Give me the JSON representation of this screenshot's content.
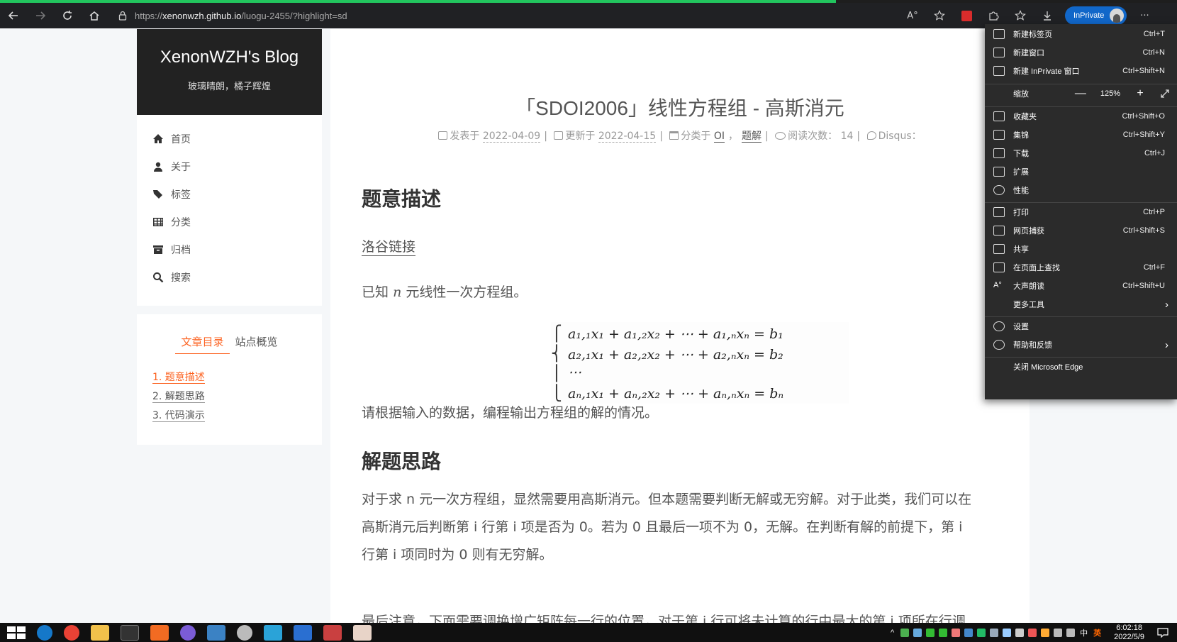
{
  "browser": {
    "page_load_progress": 0.71,
    "url_prefix": "https://",
    "url_host": "xenonwzh.github.io",
    "url_path": "/luogu-2455/?highlight=sd",
    "inprivate_label": "InPrivate",
    "more_label": "···",
    "read_aloud_label": "A°",
    "context_menu": {
      "new_tab": {
        "label": "新建标签页",
        "shortcut": "Ctrl+T"
      },
      "new_window": {
        "label": "新建窗口",
        "shortcut": "Ctrl+N"
      },
      "new_inprivate": {
        "label": "新建 InPrivate 窗口",
        "shortcut": "Ctrl+Shift+N"
      },
      "zoom": {
        "label": "缩放",
        "value": "125%",
        "minus": "—",
        "plus": "+"
      },
      "favorites": {
        "label": "收藏夹",
        "shortcut": "Ctrl+Shift+O"
      },
      "collections": {
        "label": "集锦",
        "shortcut": "Ctrl+Shift+Y"
      },
      "downloads": {
        "label": "下载",
        "shortcut": "Ctrl+J"
      },
      "extensions": {
        "label": "扩展"
      },
      "performance": {
        "label": "性能"
      },
      "print": {
        "label": "打印",
        "shortcut": "Ctrl+P"
      },
      "web_capture": {
        "label": "网页捕获",
        "shortcut": "Ctrl+Shift+S"
      },
      "share": {
        "label": "共享"
      },
      "find": {
        "label": "在页面上查找",
        "shortcut": "Ctrl+F"
      },
      "read_aloud": {
        "label": "大声朗读",
        "shortcut": "Ctrl+Shift+U"
      },
      "more_tools": {
        "label": "更多工具"
      },
      "settings": {
        "label": "设置"
      },
      "help": {
        "label": "帮助和反馈"
      },
      "close": {
        "label": "关闭 Microsoft Edge"
      }
    }
  },
  "blog": {
    "title": "XenonWZH's Blog",
    "subtitle": "玻璃晴朗，橘子辉煌",
    "menu": [
      "首页",
      "关于",
      "标签",
      "分类",
      "归档",
      "搜索"
    ],
    "toc_tabs": [
      "文章目录",
      "站点概览"
    ],
    "toc": [
      "1. 题意描述",
      "2. 解题思路",
      "3. 代码演示"
    ]
  },
  "post": {
    "title": "「SDOI2006」线性方程组 - 高斯消元",
    "meta": {
      "posted_label": "发表于",
      "posted_date": "2022-04-09",
      "updated_label": "更新于",
      "updated_date": "2022-04-15",
      "category_label": "分类于",
      "category_1": "OI",
      "category_2": "题解",
      "views_label": "阅读次数：",
      "views": "14",
      "disqus_label": "Disqus："
    },
    "section1_title": "题意描述",
    "luogu_link": "洛谷链接",
    "intro_a": "已知",
    "intro_var": "n",
    "intro_b": "元线性一次方程组。",
    "eq_rows": [
      {
        "lhs": "a₁,₁x₁ + a₁,₂x₂ + ⋯ + a₁,ₙxₙ",
        "rhs": "b₁"
      },
      {
        "lhs": "a₂,₁x₁ + a₂,₂x₂ + ⋯ + a₂,ₙxₙ",
        "rhs": "b₂"
      },
      {
        "lhs": "⋯",
        "rhs": ""
      },
      {
        "lhs": "aₙ,₁x₁ + aₙ,₂x₂ + ⋯ + aₙ,ₙxₙ",
        "rhs": "bₙ"
      }
    ],
    "request": "请根据输入的数据，编程输出方程组的解的情况。",
    "section2_title": "解题思路",
    "para2_line1": "对于求 n 元一次方程组，显然需要用高斯消元。但本题需要判断无解或无穷解。对于此类，我们可以在",
    "para2_line2": "高斯消元后判断第 i 行第 i 项是否为 0。若为 0 且最后一项不为 0，无解。在判断有解的前提下，第 i",
    "para2_line3": "行第 i 项同时为 0 则有无穷解。",
    "cut_line": "最后注意，下面需要调换增广矩阵每一行的位置，对于第 i 行可将未计算的行中最大的第 i 项所在行调"
  },
  "taskbar": {
    "time": "6:02:18",
    "date": "2022/5/9",
    "ime": "中",
    "ime_mode": "英"
  },
  "colors": {
    "accent": "#fc6423",
    "brand_bg": "#222222",
    "menu_bg": "#2b2b2b",
    "inprivate": "#1167c9",
    "progress": "#22c55e"
  }
}
